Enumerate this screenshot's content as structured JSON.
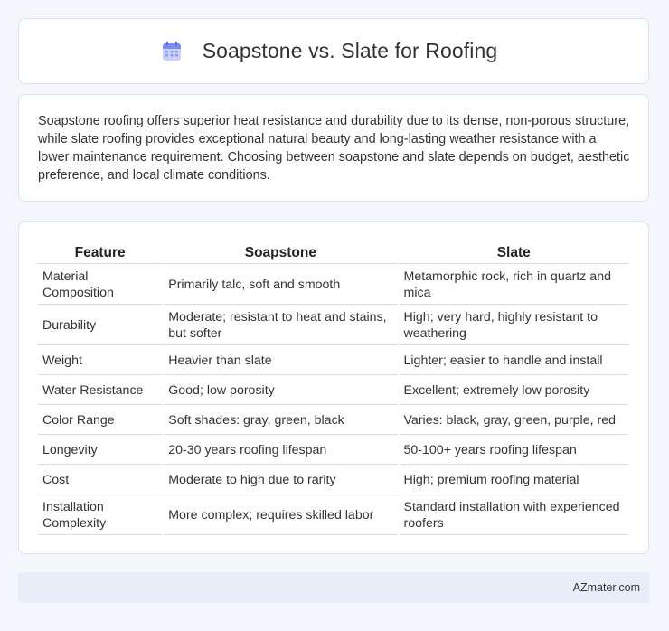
{
  "header": {
    "title": "Soapstone vs. Slate for Roofing",
    "icon": "calendar-icon",
    "accent": "#7b8cf0"
  },
  "summary": {
    "text": "Soapstone roofing offers superior heat resistance and durability due to its dense, non-porous structure, while slate roofing provides exceptional natural beauty and long-lasting weather resistance with a lower maintenance requirement. Choosing between soapstone and slate depends on budget, aesthetic preference, and local climate conditions."
  },
  "table": {
    "headers": [
      "Feature",
      "Soapstone",
      "Slate"
    ],
    "rows": [
      [
        "Material Composition",
        "Primarily talc, soft and smooth",
        "Metamorphic rock, rich in quartz and mica"
      ],
      [
        "Durability",
        "Moderate; resistant to heat and stains, but softer",
        "High; very hard, highly resistant to weathering"
      ],
      [
        "Weight",
        "Heavier than slate",
        "Lighter; easier to handle and install"
      ],
      [
        "Water Resistance",
        "Good; low porosity",
        "Excellent; extremely low porosity"
      ],
      [
        "Color Range",
        "Soft shades: gray, green, black",
        "Varies: black, gray, green, purple, red"
      ],
      [
        "Longevity",
        "20-30 years roofing lifespan",
        "50-100+ years roofing lifespan"
      ],
      [
        "Cost",
        "Moderate to high due to rarity",
        "High; premium roofing material"
      ],
      [
        "Installation Complexity",
        "More complex; requires skilled labor",
        "Standard installation with experienced roofers"
      ]
    ]
  },
  "footer": {
    "brand": "AZmater.com"
  }
}
